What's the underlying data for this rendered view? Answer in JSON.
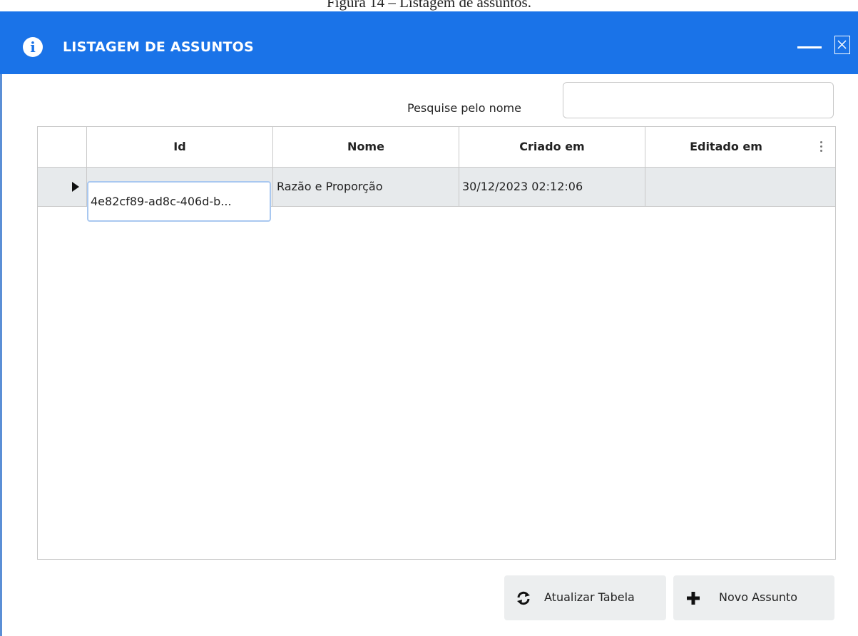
{
  "caption": "Figura 14 – Listagem de assuntos.",
  "window": {
    "title": "LISTAGEM DE ASSUNTOS",
    "info_icon": "info-circle-icon",
    "title_color": "#1a73e8"
  },
  "search": {
    "label": "Pesquise pelo nome",
    "value": "",
    "placeholder": ""
  },
  "table": {
    "columns": [
      "Id",
      "Nome",
      "Criado em",
      "Editado em"
    ],
    "rows": [
      {
        "id": "4e82cf89-ad8c-406d-b...",
        "nome": "Razão e Proporção",
        "criado_em": "30/12/2023 02:12:06",
        "editado_em": ""
      }
    ]
  },
  "buttons": {
    "refresh_label": "Atualizar Tabela",
    "refresh_icon": "refresh-icon",
    "new_label": "Novo Assunto",
    "new_icon": "plus-icon"
  }
}
